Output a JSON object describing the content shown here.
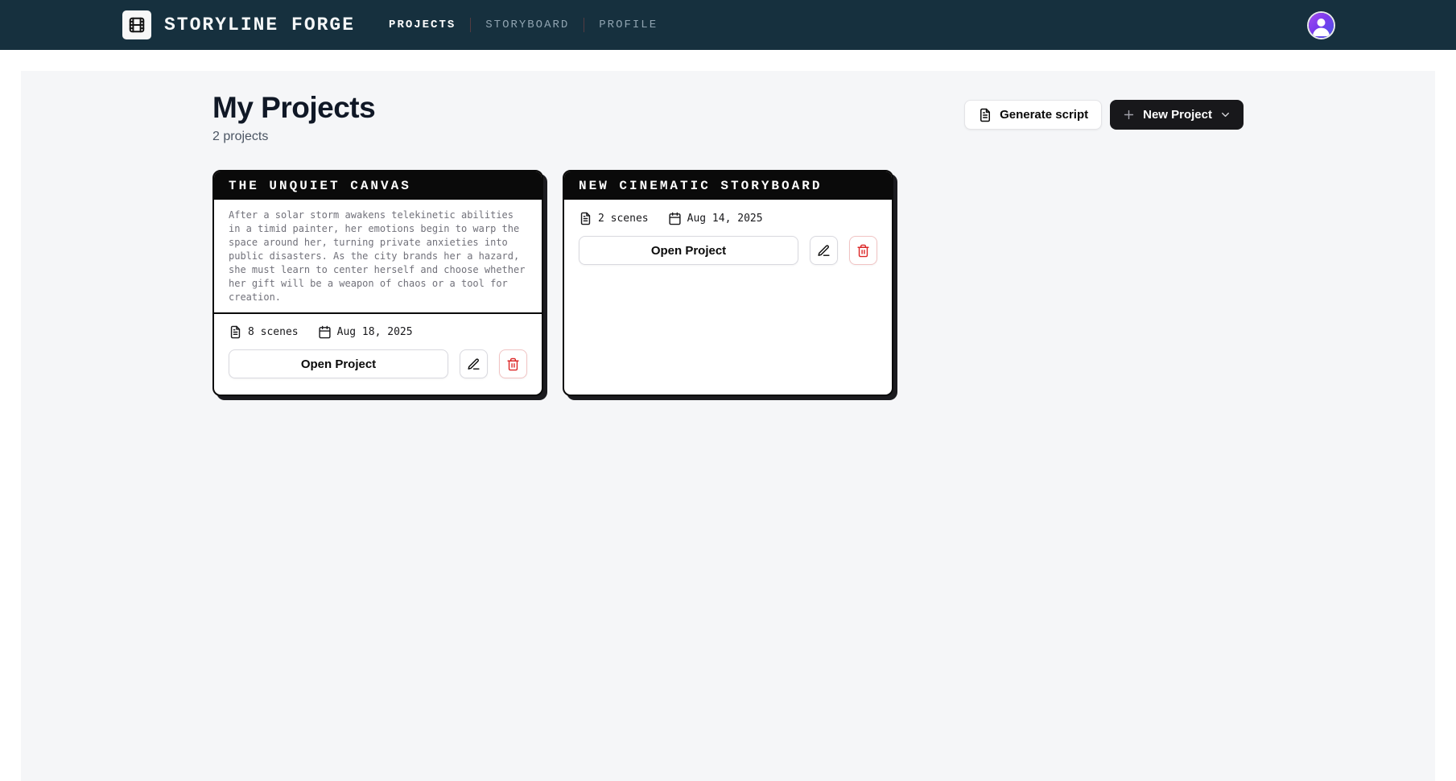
{
  "header": {
    "brand": "STORYLINE FORGE",
    "nav": [
      {
        "label": "PROJECTS",
        "active": true
      },
      {
        "label": "STORYBOARD",
        "active": false
      },
      {
        "label": "PROFILE",
        "active": false
      }
    ]
  },
  "page": {
    "title": "My Projects",
    "subtitle": "2 projects",
    "actions": {
      "generate_script": "Generate script",
      "new_project": "New Project"
    }
  },
  "projects": [
    {
      "title": "THE UNQUIET CANVAS",
      "description": "After a solar storm awakens telekinetic abilities in a timid painter, her emotions begin to warp the space around her, turning private anxieties into public disasters. As the city brands her a hazard, she must learn to center herself and choose whether her gift will be a weapon of chaos or a tool for creation.",
      "scenes": "8 scenes",
      "date": "Aug 18, 2025",
      "open_label": "Open Project"
    },
    {
      "title": "NEW CINEMATIC STORYBOARD",
      "scenes": "2 scenes",
      "date": "Aug 14, 2025",
      "open_label": "Open Project"
    }
  ],
  "colors": {
    "header_bg": "#16303e",
    "card_shadow": "#1b1b1f",
    "danger": "#dc2626",
    "avatar_gradient_start": "#a34df0",
    "avatar_gradient_end": "#4657e8",
    "panel_bg": "#f5f6f8"
  }
}
